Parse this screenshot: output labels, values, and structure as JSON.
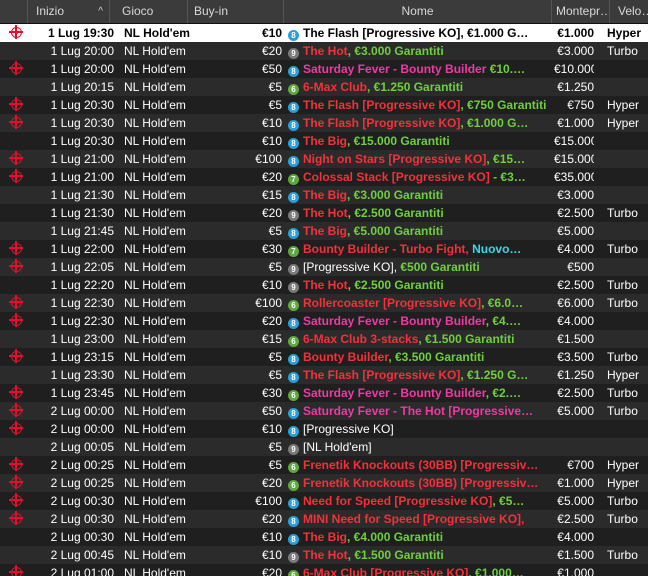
{
  "header": {
    "columns": [
      {
        "label": "Inizio",
        "sorted": true
      },
      {
        "label": "Gioco"
      },
      {
        "label": "Buy-in"
      },
      {
        "label": "Nome"
      },
      {
        "label": "Montepr…"
      },
      {
        "label": "Velo…"
      }
    ],
    "sort_glyph": "^"
  },
  "rows": [
    {
      "registered": true,
      "selected": true,
      "date": "1 Lug",
      "time": "19:30",
      "game": "NL Hold'em",
      "buyin": "€10",
      "badge": "8",
      "name": [
        {
          "t": "The Flash [Progressive KO], €1.000 G…",
          "c": "plain"
        }
      ],
      "prize": "€1.000",
      "speed": "Hyper"
    },
    {
      "registered": false,
      "date": "1 Lug",
      "time": "20:00",
      "game": "NL Hold'em",
      "buyin": "€20",
      "badge": "9",
      "name": [
        {
          "t": "The Hot",
          "c": "red"
        },
        {
          "t": ", €3.000 Garantiti",
          "c": "green"
        }
      ],
      "prize": "€3.000",
      "speed": "Turbo"
    },
    {
      "registered": true,
      "date": "1 Lug",
      "time": "20:00",
      "game": "NL Hold'em",
      "buyin": "€50",
      "badge": "8",
      "name": [
        {
          "t": "Saturday Fever - Bounty Builder",
          "c": "pink"
        },
        {
          "t": " €10.…",
          "c": "green"
        }
      ],
      "prize": "€10.000",
      "speed": ""
    },
    {
      "registered": false,
      "date": "1 Lug",
      "time": "20:15",
      "game": "NL Hold'em",
      "buyin": "€5",
      "badge": "6",
      "name": [
        {
          "t": "6-Max Club",
          "c": "red"
        },
        {
          "t": ", €1.250 Garantiti",
          "c": "green"
        }
      ],
      "prize": "€1.250",
      "speed": ""
    },
    {
      "registered": true,
      "date": "1 Lug",
      "time": "20:30",
      "game": "NL Hold'em",
      "buyin": "€5",
      "badge": "8",
      "name": [
        {
          "t": "The Flash [Progressive KO]",
          "c": "red"
        },
        {
          "t": ", €750 Garantiti",
          "c": "green"
        }
      ],
      "prize": "€750",
      "speed": "Hyper"
    },
    {
      "registered": true,
      "date": "1 Lug",
      "time": "20:30",
      "game": "NL Hold'em",
      "buyin": "€10",
      "badge": "8",
      "name": [
        {
          "t": "The Flash [Progressive KO]",
          "c": "red"
        },
        {
          "t": ", €1.000 G…",
          "c": "green"
        }
      ],
      "prize": "€1.000",
      "speed": "Hyper"
    },
    {
      "registered": false,
      "date": "1 Lug",
      "time": "20:30",
      "game": "NL Hold'em",
      "buyin": "€10",
      "badge": "8",
      "name": [
        {
          "t": "The Big",
          "c": "red"
        },
        {
          "t": ", €15.000 Garantiti",
          "c": "green"
        }
      ],
      "prize": "€15.000",
      "speed": ""
    },
    {
      "registered": true,
      "date": "1 Lug",
      "time": "21:00",
      "game": "NL Hold'em",
      "buyin": "€100",
      "badge": "8",
      "name": [
        {
          "t": "Night on Stars [Progressive KO]",
          "c": "red"
        },
        {
          "t": ", €15…",
          "c": "green"
        }
      ],
      "prize": "€15.000",
      "speed": ""
    },
    {
      "registered": true,
      "date": "1 Lug",
      "time": "21:00",
      "game": "NL Hold'em",
      "buyin": "€20",
      "badge": "7",
      "name": [
        {
          "t": "Colossal Stack [Progressive KO]",
          "c": "red"
        },
        {
          "t": " - €3…",
          "c": "green"
        }
      ],
      "prize": "€35.000",
      "speed": ""
    },
    {
      "registered": false,
      "date": "1 Lug",
      "time": "21:30",
      "game": "NL Hold'em",
      "buyin": "€15",
      "badge": "8",
      "name": [
        {
          "t": "The Big",
          "c": "red"
        },
        {
          "t": ", €3.000 Garantiti",
          "c": "green"
        }
      ],
      "prize": "€3.000",
      "speed": ""
    },
    {
      "registered": false,
      "date": "1 Lug",
      "time": "21:30",
      "game": "NL Hold'em",
      "buyin": "€20",
      "badge": "9",
      "name": [
        {
          "t": "The Hot",
          "c": "red"
        },
        {
          "t": ", €2.500 Garantiti",
          "c": "green"
        }
      ],
      "prize": "€2.500",
      "speed": "Turbo"
    },
    {
      "registered": false,
      "date": "1 Lug",
      "time": "21:45",
      "game": "NL Hold'em",
      "buyin": "€5",
      "badge": "8",
      "name": [
        {
          "t": "The Big",
          "c": "red"
        },
        {
          "t": ", €5.000 Garantiti",
          "c": "green"
        }
      ],
      "prize": "€5.000",
      "speed": ""
    },
    {
      "registered": true,
      "date": "1 Lug",
      "time": "22:00",
      "game": "NL Hold'em",
      "buyin": "€30",
      "badge": "7",
      "name": [
        {
          "t": "Bounty Builder - Turbo Fight, ",
          "c": "red"
        },
        {
          "t": "Nuovo…",
          "c": "cyan"
        }
      ],
      "prize": "€4.000",
      "speed": "Turbo"
    },
    {
      "registered": true,
      "date": "1 Lug",
      "time": "22:05",
      "game": "NL Hold'em",
      "buyin": "€5",
      "badge": "9",
      "name": [
        {
          "t": "[Progressive KO], ",
          "c": "plain"
        },
        {
          "t": "€500 Garantiti",
          "c": "green"
        }
      ],
      "prize": "€500",
      "speed": ""
    },
    {
      "registered": false,
      "date": "1 Lug",
      "time": "22:20",
      "game": "NL Hold'em",
      "buyin": "€10",
      "badge": "9",
      "name": [
        {
          "t": "The Hot",
          "c": "red"
        },
        {
          "t": ", €2.500 Garantiti",
          "c": "green"
        }
      ],
      "prize": "€2.500",
      "speed": "Turbo"
    },
    {
      "registered": true,
      "date": "1 Lug",
      "time": "22:30",
      "game": "NL Hold'em",
      "buyin": "€100",
      "badge": "6",
      "name": [
        {
          "t": "Rollercoaster [Progressive KO]",
          "c": "red"
        },
        {
          "t": ", €6.0…",
          "c": "green"
        }
      ],
      "prize": "€6.000",
      "speed": "Turbo"
    },
    {
      "registered": true,
      "date": "1 Lug",
      "time": "22:30",
      "game": "NL Hold'em",
      "buyin": "€20",
      "badge": "8",
      "name": [
        {
          "t": "Saturday Fever - Bounty Builder",
          "c": "pink"
        },
        {
          "t": ", €4.…",
          "c": "green"
        }
      ],
      "prize": "€4.000",
      "speed": ""
    },
    {
      "registered": false,
      "date": "1 Lug",
      "time": "23:00",
      "game": "NL Hold'em",
      "buyin": "€15",
      "badge": "6",
      "name": [
        {
          "t": "6-Max Club 3-stacks",
          "c": "red"
        },
        {
          "t": ", €1.500 Garantiti",
          "c": "green"
        }
      ],
      "prize": "€1.500",
      "speed": ""
    },
    {
      "registered": true,
      "date": "1 Lug",
      "time": "23:15",
      "game": "NL Hold'em",
      "buyin": "€5",
      "badge": "8",
      "name": [
        {
          "t": "Bounty Builder",
          "c": "red"
        },
        {
          "t": ", €3.500 Garantiti",
          "c": "green"
        }
      ],
      "prize": "€3.500",
      "speed": "Turbo"
    },
    {
      "registered": false,
      "date": "1 Lug",
      "time": "23:30",
      "game": "NL Hold'em",
      "buyin": "€5",
      "badge": "8",
      "name": [
        {
          "t": "The Flash [Progressive KO]",
          "c": "red"
        },
        {
          "t": ", €1.250 G…",
          "c": "green"
        }
      ],
      "prize": "€1.250",
      "speed": "Hyper"
    },
    {
      "registered": true,
      "date": "1 Lug",
      "time": "23:45",
      "game": "NL Hold'em",
      "buyin": "€30",
      "badge": "6",
      "name": [
        {
          "t": "Saturday Fever - Bounty Builder",
          "c": "pink"
        },
        {
          "t": ", €2.…",
          "c": "green"
        }
      ],
      "prize": "€2.500",
      "speed": "Turbo"
    },
    {
      "registered": true,
      "date": "2 Lug",
      "time": "00:00",
      "game": "NL Hold'em",
      "buyin": "€50",
      "badge": "8",
      "name": [
        {
          "t": "Saturday Fever - The Hot [Progressive…",
          "c": "pink"
        }
      ],
      "prize": "€5.000",
      "speed": "Turbo"
    },
    {
      "registered": true,
      "date": "2 Lug",
      "time": "00:00",
      "game": "NL Hold'em",
      "buyin": "€10",
      "badge": "8",
      "name": [
        {
          "t": "[Progressive KO]",
          "c": "plain"
        }
      ],
      "prize": "",
      "speed": ""
    },
    {
      "registered": false,
      "date": "2 Lug",
      "time": "00:05",
      "game": "NL Hold'em",
      "buyin": "€5",
      "badge": "9",
      "name": [
        {
          "t": "[NL Hold'em]",
          "c": "plain"
        }
      ],
      "prize": "",
      "speed": ""
    },
    {
      "registered": true,
      "date": "2 Lug",
      "time": "00:25",
      "game": "NL Hold'em",
      "buyin": "€5",
      "badge": "6",
      "name": [
        {
          "t": "Frenetik Knockouts (30BB) [Progressiv…",
          "c": "red"
        }
      ],
      "prize": "€700",
      "speed": "Hyper"
    },
    {
      "registered": true,
      "date": "2 Lug",
      "time": "00:25",
      "game": "NL Hold'em",
      "buyin": "€20",
      "badge": "6",
      "name": [
        {
          "t": "Frenetik Knockouts (30BB) [Progressiv…",
          "c": "red"
        }
      ],
      "prize": "€1.000",
      "speed": "Hyper"
    },
    {
      "registered": true,
      "date": "2 Lug",
      "time": "00:30",
      "game": "NL Hold'em",
      "buyin": "€100",
      "badge": "8",
      "name": [
        {
          "t": "Need for Speed [Progressive KO]",
          "c": "red"
        },
        {
          "t": ", €5…",
          "c": "green"
        }
      ],
      "prize": "€5.000",
      "speed": "Turbo"
    },
    {
      "registered": true,
      "date": "2 Lug",
      "time": "00:30",
      "game": "NL Hold'em",
      "buyin": "€20",
      "badge": "8",
      "name": [
        {
          "t": "MINI Need for Speed [Progressive KO],",
          "c": "red"
        }
      ],
      "prize": "€2.500",
      "speed": "Turbo"
    },
    {
      "registered": false,
      "date": "2 Lug",
      "time": "00:30",
      "game": "NL Hold'em",
      "buyin": "€10",
      "badge": "8",
      "name": [
        {
          "t": "The Big",
          "c": "red"
        },
        {
          "t": ", €4.000 Garantiti",
          "c": "green"
        }
      ],
      "prize": "€4.000",
      "speed": ""
    },
    {
      "registered": false,
      "date": "2 Lug",
      "time": "00:45",
      "game": "NL Hold'em",
      "buyin": "€10",
      "badge": "9",
      "name": [
        {
          "t": "The Hot",
          "c": "red"
        },
        {
          "t": ", €1.500 Garantiti",
          "c": "green"
        }
      ],
      "prize": "€1.500",
      "speed": "Turbo"
    },
    {
      "registered": true,
      "date": "2 Lug",
      "time": "01:00",
      "game": "NL Hold'em",
      "buyin": "€20",
      "badge": "6",
      "name": [
        {
          "t": "6-Max Club [Progressive KO]",
          "c": "red"
        },
        {
          "t": ", €1.000…",
          "c": "green"
        }
      ],
      "prize": "€1.000",
      "speed": ""
    }
  ]
}
